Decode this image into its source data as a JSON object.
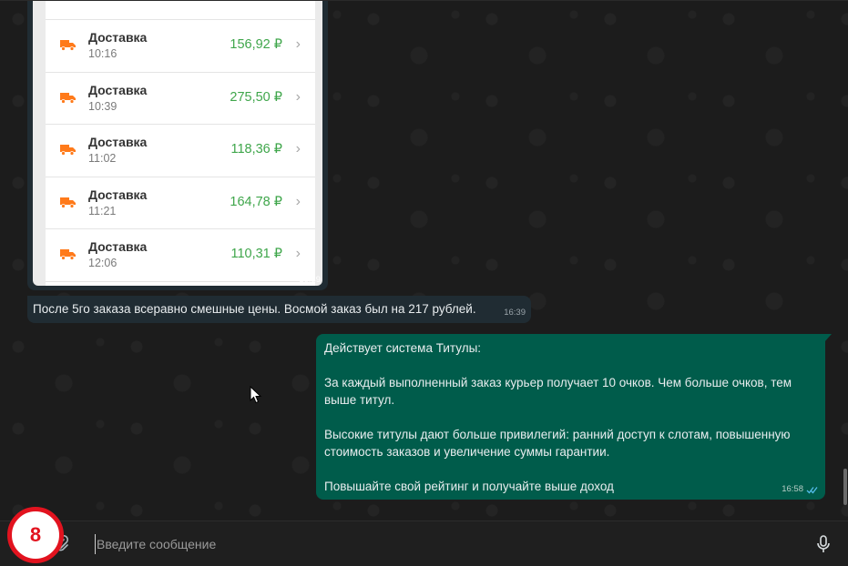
{
  "chat": {
    "image_message": {
      "time": "16:39",
      "deliveries": [
        {
          "title": "Доставка",
          "time": "10:16",
          "amount": "156,92 ₽"
        },
        {
          "title": "Доставка",
          "time": "10:39",
          "amount": "275,50 ₽"
        },
        {
          "title": "Доставка",
          "time": "11:02",
          "amount": "118,36 ₽"
        },
        {
          "title": "Доставка",
          "time": "11:21",
          "amount": "164,78 ₽"
        },
        {
          "title": "Доставка",
          "time": "12:06",
          "amount": "110,31 ₽"
        }
      ]
    },
    "incoming": {
      "text": "После 5го заказа всеравно смешные цены. Восмой заказ был на 217 рублей.",
      "time": "16:39"
    },
    "outgoing": {
      "p1": "Действует система Титулы:",
      "p2": "За каждый выполненный заказ курьер получает 10 очков. Чем больше очков, тем выше титул.",
      "p3": "Высокие титулы дают больше привилегий: ранний доступ к слотам, повышенную стоимость заказов и увеличение суммы гарантии.",
      "p4": "Повышайте свой рейтинг и получайте выше доход",
      "time": "16:58"
    }
  },
  "composer": {
    "placeholder": "Введите сообщение",
    "value": ""
  },
  "badge": {
    "label": "8"
  },
  "icons": {
    "delivery": "truck-icon",
    "attach": "paperclip-icon",
    "mic": "microphone-icon",
    "read": "double-check-icon",
    "cursor": "mouse-cursor-icon"
  },
  "colors": {
    "outgoing_bubble": "#005c4b",
    "incoming_bubble": "#202c33",
    "amount": "#3fa64b",
    "truck": "#ff7a1a",
    "badge_ring": "#e2131f"
  }
}
